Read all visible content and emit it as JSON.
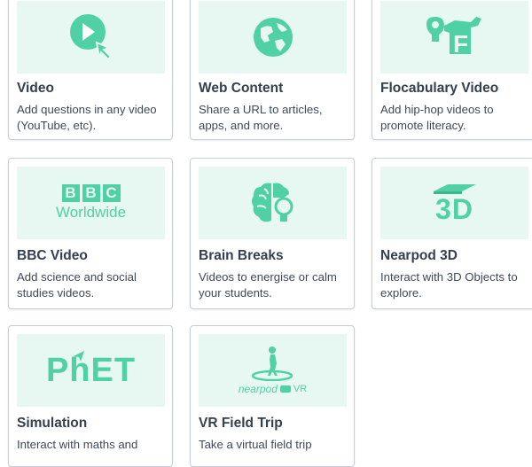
{
  "accent_color": "#4fd1a5",
  "thumb_bg": "#e7f8f2",
  "cards": [
    {
      "title": "Video",
      "description": "Add questions in any video (YouTube, etc).",
      "icon": "play-cursor-icon"
    },
    {
      "title": "Web Content",
      "description": "Share a URL to articles, apps, and more.",
      "icon": "globe-icon"
    },
    {
      "title": "Flocabulary Video",
      "description": "Add hip-hop videos to promote literacy.",
      "icon": "flocabulary-logo"
    },
    {
      "title": "BBC Video",
      "description": "Add science and social studies videos.",
      "icon": "bbc-worldwide-logo",
      "logo": {
        "letters": [
          "B",
          "B",
          "C"
        ],
        "word": "Worldwide"
      }
    },
    {
      "title": "Brain Breaks",
      "description": "Videos to energise or calm your students.",
      "icon": "brain-lightbulb-icon"
    },
    {
      "title": "Nearpod 3D",
      "description": "Interact with 3D Objects to explore.",
      "icon": "3d-cube-icon",
      "logo": {
        "text": "3D"
      }
    },
    {
      "title": "Simulation",
      "description": "Interact with maths and",
      "icon": "phet-logo",
      "logo": {
        "text": "PhET"
      }
    },
    {
      "title": "VR Field Trip",
      "description": "Take a virtual field trip",
      "icon": "nearpod-vr-icon",
      "logo": {
        "word": "nearpod",
        "suffix": "VR"
      }
    }
  ]
}
